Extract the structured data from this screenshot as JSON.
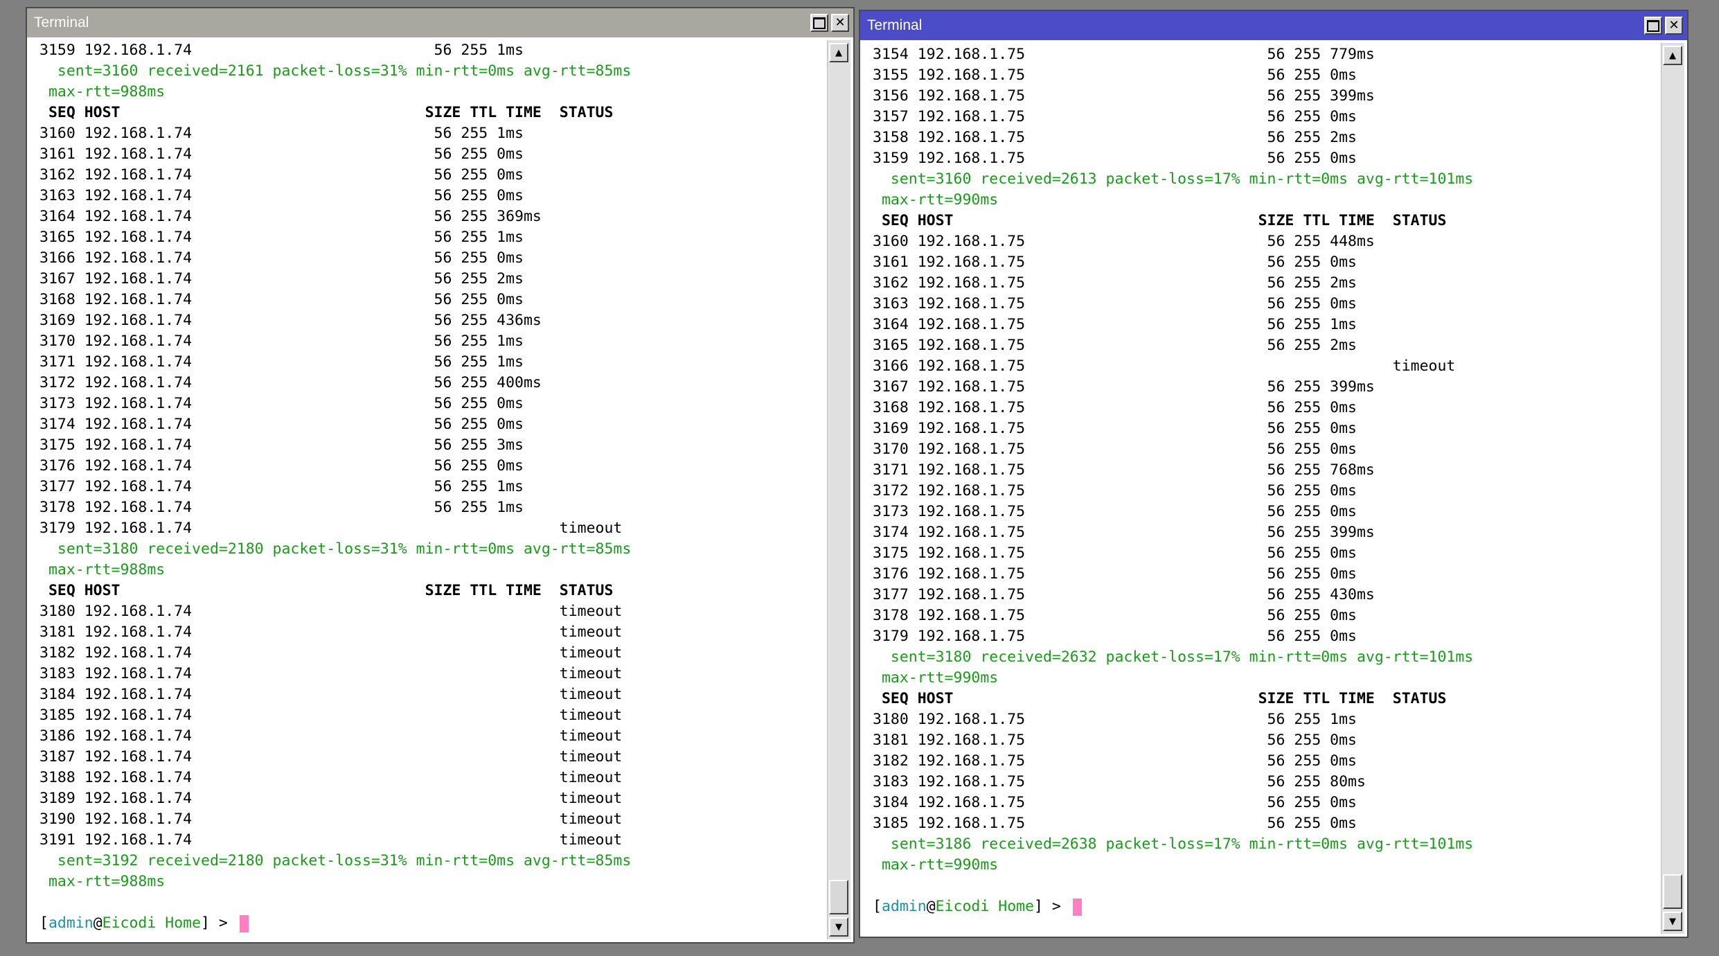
{
  "left_window": {
    "title": "Terminal",
    "lines": [
      {
        "type": "row",
        "text": "3159 192.168.1.74                           56 255 1ms"
      },
      {
        "type": "stat",
        "text": "  sent=3160 received=2161 packet-loss=31% min-rtt=0ms avg-rtt=85ms"
      },
      {
        "type": "stat",
        "text": " max-rtt=988ms"
      },
      {
        "type": "hdr",
        "text": " SEQ HOST                                  SIZE TTL TIME  STATUS"
      },
      {
        "type": "row",
        "text": "3160 192.168.1.74                           56 255 1ms"
      },
      {
        "type": "row",
        "text": "3161 192.168.1.74                           56 255 0ms"
      },
      {
        "type": "row",
        "text": "3162 192.168.1.74                           56 255 0ms"
      },
      {
        "type": "row",
        "text": "3163 192.168.1.74                           56 255 0ms"
      },
      {
        "type": "row",
        "text": "3164 192.168.1.74                           56 255 369ms"
      },
      {
        "type": "row",
        "text": "3165 192.168.1.74                           56 255 1ms"
      },
      {
        "type": "row",
        "text": "3166 192.168.1.74                           56 255 0ms"
      },
      {
        "type": "row",
        "text": "3167 192.168.1.74                           56 255 2ms"
      },
      {
        "type": "row",
        "text": "3168 192.168.1.74                           56 255 0ms"
      },
      {
        "type": "row",
        "text": "3169 192.168.1.74                           56 255 436ms"
      },
      {
        "type": "row",
        "text": "3170 192.168.1.74                           56 255 1ms"
      },
      {
        "type": "row",
        "text": "3171 192.168.1.74                           56 255 1ms"
      },
      {
        "type": "row",
        "text": "3172 192.168.1.74                           56 255 400ms"
      },
      {
        "type": "row",
        "text": "3173 192.168.1.74                           56 255 0ms"
      },
      {
        "type": "row",
        "text": "3174 192.168.1.74                           56 255 0ms"
      },
      {
        "type": "row",
        "text": "3175 192.168.1.74                           56 255 3ms"
      },
      {
        "type": "row",
        "text": "3176 192.168.1.74                           56 255 0ms"
      },
      {
        "type": "row",
        "text": "3177 192.168.1.74                           56 255 1ms"
      },
      {
        "type": "row",
        "text": "3178 192.168.1.74                           56 255 1ms"
      },
      {
        "type": "row",
        "text": "3179 192.168.1.74                                         timeout"
      },
      {
        "type": "stat",
        "text": "  sent=3180 received=2180 packet-loss=31% min-rtt=0ms avg-rtt=85ms"
      },
      {
        "type": "stat",
        "text": " max-rtt=988ms"
      },
      {
        "type": "hdr",
        "text": " SEQ HOST                                  SIZE TTL TIME  STATUS"
      },
      {
        "type": "row",
        "text": "3180 192.168.1.74                                         timeout"
      },
      {
        "type": "row",
        "text": "3181 192.168.1.74                                         timeout"
      },
      {
        "type": "row",
        "text": "3182 192.168.1.74                                         timeout"
      },
      {
        "type": "row",
        "text": "3183 192.168.1.74                                         timeout"
      },
      {
        "type": "row",
        "text": "3184 192.168.1.74                                         timeout"
      },
      {
        "type": "row",
        "text": "3185 192.168.1.74                                         timeout"
      },
      {
        "type": "row",
        "text": "3186 192.168.1.74                                         timeout"
      },
      {
        "type": "row",
        "text": "3187 192.168.1.74                                         timeout"
      },
      {
        "type": "row",
        "text": "3188 192.168.1.74                                         timeout"
      },
      {
        "type": "row",
        "text": "3189 192.168.1.74                                         timeout"
      },
      {
        "type": "row",
        "text": "3190 192.168.1.74                                         timeout"
      },
      {
        "type": "row",
        "text": "3191 192.168.1.74                                         timeout"
      },
      {
        "type": "stat",
        "text": "  sent=3192 received=2180 packet-loss=31% min-rtt=0ms avg-rtt=85ms"
      },
      {
        "type": "stat",
        "text": " max-rtt=988ms"
      },
      {
        "type": "blank",
        "text": ""
      }
    ],
    "prompt": {
      "open": "[",
      "user": "admin",
      "at": "@",
      "host": "Eicodi Home",
      "close": "] > "
    }
  },
  "right_window": {
    "title": "Terminal",
    "lines": [
      {
        "type": "row",
        "text": "3154 192.168.1.75                           56 255 779ms"
      },
      {
        "type": "row",
        "text": "3155 192.168.1.75                           56 255 0ms"
      },
      {
        "type": "row",
        "text": "3156 192.168.1.75                           56 255 399ms"
      },
      {
        "type": "row",
        "text": "3157 192.168.1.75                           56 255 0ms"
      },
      {
        "type": "row",
        "text": "3158 192.168.1.75                           56 255 2ms"
      },
      {
        "type": "row",
        "text": "3159 192.168.1.75                           56 255 0ms"
      },
      {
        "type": "stat",
        "text": "  sent=3160 received=2613 packet-loss=17% min-rtt=0ms avg-rtt=101ms"
      },
      {
        "type": "stat",
        "text": " max-rtt=990ms"
      },
      {
        "type": "hdr",
        "text": " SEQ HOST                                  SIZE TTL TIME  STATUS"
      },
      {
        "type": "row",
        "text": "3160 192.168.1.75                           56 255 448ms"
      },
      {
        "type": "row",
        "text": "3161 192.168.1.75                           56 255 0ms"
      },
      {
        "type": "row",
        "text": "3162 192.168.1.75                           56 255 2ms"
      },
      {
        "type": "row",
        "text": "3163 192.168.1.75                           56 255 0ms"
      },
      {
        "type": "row",
        "text": "3164 192.168.1.75                           56 255 1ms"
      },
      {
        "type": "row",
        "text": "3165 192.168.1.75                           56 255 2ms"
      },
      {
        "type": "row",
        "text": "3166 192.168.1.75                                         timeout"
      },
      {
        "type": "row",
        "text": "3167 192.168.1.75                           56 255 399ms"
      },
      {
        "type": "row",
        "text": "3168 192.168.1.75                           56 255 0ms"
      },
      {
        "type": "row",
        "text": "3169 192.168.1.75                           56 255 0ms"
      },
      {
        "type": "row",
        "text": "3170 192.168.1.75                           56 255 0ms"
      },
      {
        "type": "row",
        "text": "3171 192.168.1.75                           56 255 768ms"
      },
      {
        "type": "row",
        "text": "3172 192.168.1.75                           56 255 0ms"
      },
      {
        "type": "row",
        "text": "3173 192.168.1.75                           56 255 0ms"
      },
      {
        "type": "row",
        "text": "3174 192.168.1.75                           56 255 399ms"
      },
      {
        "type": "row",
        "text": "3175 192.168.1.75                           56 255 0ms"
      },
      {
        "type": "row",
        "text": "3176 192.168.1.75                           56 255 0ms"
      },
      {
        "type": "row",
        "text": "3177 192.168.1.75                           56 255 430ms"
      },
      {
        "type": "row",
        "text": "3178 192.168.1.75                           56 255 0ms"
      },
      {
        "type": "row",
        "text": "3179 192.168.1.75                           56 255 0ms"
      },
      {
        "type": "stat",
        "text": "  sent=3180 received=2632 packet-loss=17% min-rtt=0ms avg-rtt=101ms"
      },
      {
        "type": "stat",
        "text": " max-rtt=990ms"
      },
      {
        "type": "hdr",
        "text": " SEQ HOST                                  SIZE TTL TIME  STATUS"
      },
      {
        "type": "row",
        "text": "3180 192.168.1.75                           56 255 1ms"
      },
      {
        "type": "row",
        "text": "3181 192.168.1.75                           56 255 0ms"
      },
      {
        "type": "row",
        "text": "3182 192.168.1.75                           56 255 0ms"
      },
      {
        "type": "row",
        "text": "3183 192.168.1.75                           56 255 80ms"
      },
      {
        "type": "row",
        "text": "3184 192.168.1.75                           56 255 0ms"
      },
      {
        "type": "row",
        "text": "3185 192.168.1.75                           56 255 0ms"
      },
      {
        "type": "stat",
        "text": "  sent=3186 received=2638 packet-loss=17% min-rtt=0ms avg-rtt=101ms"
      },
      {
        "type": "stat",
        "text": " max-rtt=990ms"
      },
      {
        "type": "blank",
        "text": ""
      }
    ],
    "prompt": {
      "open": "[",
      "user": "admin",
      "at": "@",
      "host": "Eicodi Home",
      "close": "] > "
    }
  },
  "icons": {
    "maximize": "maximize-icon",
    "close": "close-icon",
    "scroll_up": "scroll-up-arrow-icon",
    "scroll_down": "scroll-down-arrow-icon"
  },
  "colors": {
    "active_titlebar": "#4b4dc8",
    "inactive_titlebar": "#a8a7a0",
    "stats_text": "#1b9a1b",
    "prompt_user": "#1f8fa8",
    "cursor": "#ff7fc4"
  }
}
